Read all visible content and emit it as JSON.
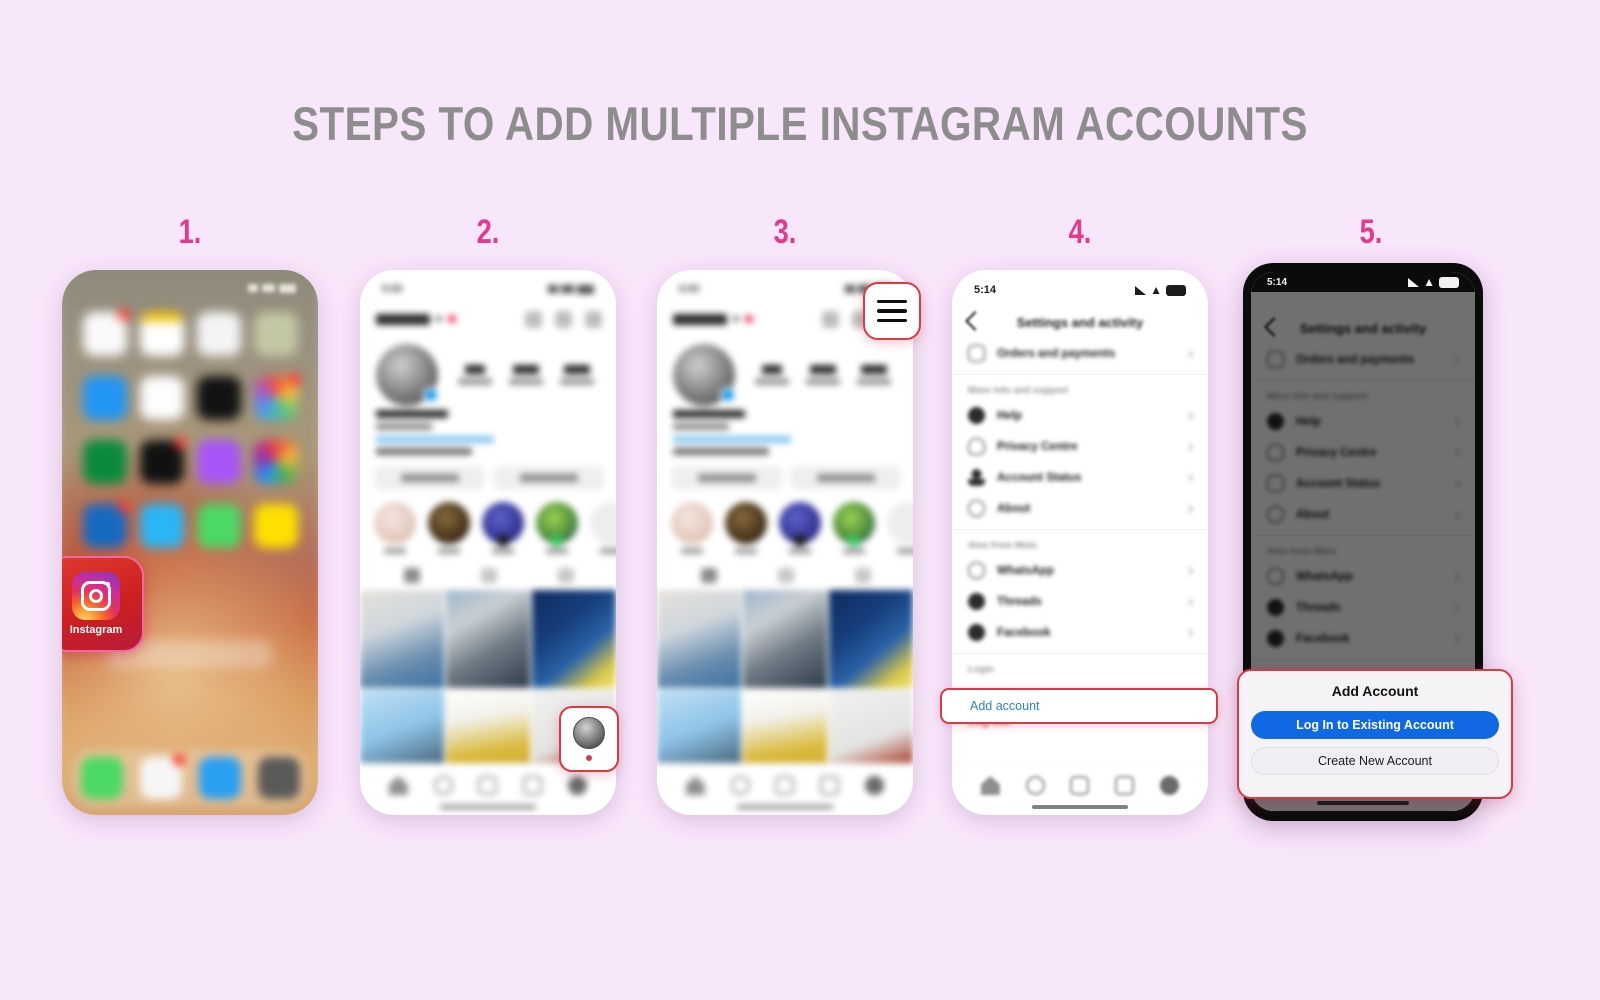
{
  "page": {
    "title": "STEPS TO ADD MULTIPLE INSTAGRAM ACCOUNTS",
    "background_color": "#f8e6fa",
    "title_color": "#8d8d8d",
    "step_number_color": "#e5388f",
    "highlight_outline_color": "#d93a48"
  },
  "steps": [
    {
      "number": "1."
    },
    {
      "number": "2."
    },
    {
      "number": "3."
    },
    {
      "number": "4."
    },
    {
      "number": "5."
    }
  ],
  "phone1": {
    "status_time": "",
    "instagram_app": {
      "label": "Instagram",
      "highlight_bg": "#cc2020",
      "highlight_border": "#f06aa0"
    }
  },
  "phone2": {
    "highlighted_element": "profile-avatar-nav"
  },
  "phone3": {
    "highlighted_element": "hamburger-menu"
  },
  "phone4": {
    "status_time": "5:14",
    "screen_title": "Settings and activity",
    "rows_top": [
      {
        "label": "Orders and payments",
        "icon": "orders-icon"
      }
    ],
    "section_support": "More info and support",
    "rows_support": [
      {
        "label": "Help",
        "icon": "help-icon"
      },
      {
        "label": "Privacy Centre",
        "icon": "privacy-icon"
      },
      {
        "label": "Account Status",
        "icon": "account-status-icon"
      },
      {
        "label": "About",
        "icon": "about-icon"
      }
    ],
    "section_meta": "Also from Meta",
    "rows_meta": [
      {
        "label": "WhatsApp",
        "icon": "whatsapp-icon"
      },
      {
        "label": "Threads",
        "icon": "threads-icon"
      },
      {
        "label": "Facebook",
        "icon": "facebook-icon"
      }
    ],
    "section_login": "Login",
    "add_account": "Add account",
    "add_account_color": "#2f80c7",
    "log_out": "Log out",
    "log_out_color": "#d93a48",
    "nav": [
      "home-icon",
      "search-icon",
      "create-icon",
      "reels-icon",
      "profile-avatar"
    ]
  },
  "phone5": {
    "status_time": "5:14",
    "screen_title": "Settings and activity",
    "modal": {
      "title": "Add Account",
      "primary_button": "Log In to Existing Account",
      "primary_color": "#1168e3",
      "secondary_button": "Create New Account"
    }
  }
}
